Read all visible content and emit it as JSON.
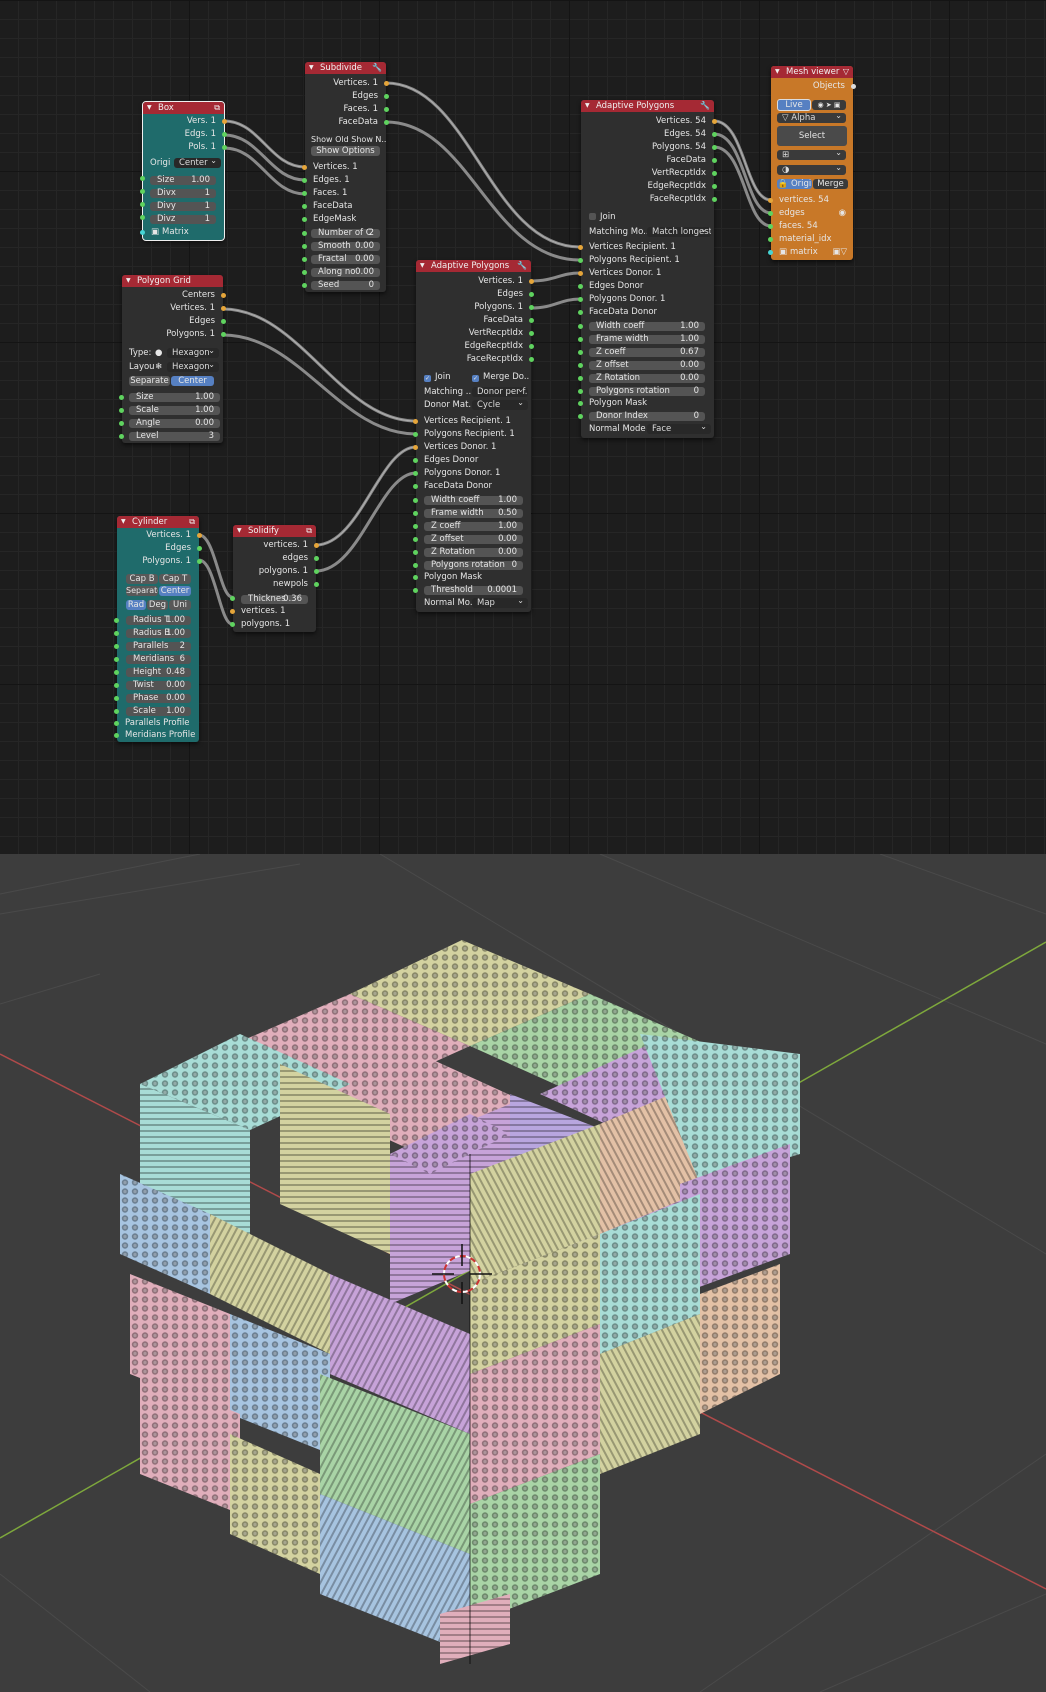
{
  "nodes": {
    "box": {
      "title": "Box",
      "outputs": [
        "Vers. 1",
        "Edgs. 1",
        "Pols. 1"
      ],
      "origin_label": "Origi",
      "origin_value": "Center",
      "fields": [
        {
          "label": "Size",
          "value": "1.00"
        },
        {
          "label": "Divx",
          "value": "1"
        },
        {
          "label": "Divy",
          "value": "1"
        },
        {
          "label": "Divz",
          "value": "1"
        }
      ],
      "matrix": "Matrix"
    },
    "subdivide": {
      "title": "Subdivide",
      "outputs": [
        "Vertices. 1",
        "Edges",
        "Faces. 1",
        "FaceData"
      ],
      "show_old": "Show Old Show N..",
      "show_options": "Show Options",
      "inputs": [
        "Vertices. 1",
        "Edges. 1",
        "Faces. 1",
        "FaceData",
        "EdgeMask"
      ],
      "fields": [
        {
          "label": "Number of C",
          "value": "2"
        },
        {
          "label": "Smooth",
          "value": "0.00"
        },
        {
          "label": "Fractal",
          "value": "0.00"
        },
        {
          "label": "Along no",
          "value": "0.00"
        },
        {
          "label": "Seed",
          "value": "0"
        }
      ]
    },
    "polygon_grid": {
      "title": "Polygon Grid",
      "outputs": [
        "Centers",
        "Vertices. 1",
        "Edges",
        "Polygons. 1"
      ],
      "type_label": "Type:",
      "type_value": "Hexagon",
      "layout_label": "Layou",
      "layout_value": "Hexagon",
      "separate": "Separate",
      "center": "Center",
      "fields": [
        {
          "label": "Size",
          "value": "1.00"
        },
        {
          "label": "Scale",
          "value": "1.00"
        },
        {
          "label": "Angle",
          "value": "0.00"
        },
        {
          "label": "Level",
          "value": "3"
        }
      ]
    },
    "cylinder": {
      "title": "Cylinder",
      "outputs": [
        "Vertices. 1",
        "Edges",
        "Polygons. 1"
      ],
      "cap_b": "Cap B",
      "cap_t": "Cap T",
      "separate": "Separate",
      "center": "Center",
      "rad": "Rad",
      "deg": "Deg",
      "uni": "Uni",
      "fields": [
        {
          "label": "Radius T",
          "value": "1.00"
        },
        {
          "label": "Radius B",
          "value": "1.00"
        },
        {
          "label": "Parallels",
          "value": "2"
        },
        {
          "label": "Meridians",
          "value": "6"
        },
        {
          "label": "Height",
          "value": "0.48"
        },
        {
          "label": "Twist",
          "value": "0.00"
        },
        {
          "label": "Phase",
          "value": "0.00"
        },
        {
          "label": "Scale",
          "value": "1.00"
        }
      ],
      "inputs": [
        "Parallels Profile",
        "Meridians Profile"
      ]
    },
    "solidify": {
      "title": "Solidify",
      "outputs": [
        "vertices. 1",
        "edges",
        "polygons. 1",
        "newpols"
      ],
      "fields": [
        {
          "label": "Thicknes",
          "value": "0.36"
        }
      ],
      "inputs": [
        "vertices. 1",
        "polygons. 1"
      ]
    },
    "adaptive1": {
      "title": "Adaptive Polygons",
      "outputs": [
        "Vertices. 1",
        "Edges",
        "Polygons. 1",
        "FaceData",
        "VertRecptIdx",
        "EdgeRecptIdx",
        "FaceRecptIdx"
      ],
      "join": "Join",
      "merge": "Merge Do..",
      "matching_label": "Matching ...",
      "matching_value": "Donor per f...",
      "donor_label": "Donor Mat...",
      "donor_value": "Cycle",
      "inputs": [
        "Vertices Recipient. 1",
        "Polygons Recipient. 1",
        "Vertices Donor. 1",
        "Edges Donor",
        "Polygons Donor. 1",
        "FaceData Donor"
      ],
      "fields": [
        {
          "label": "Width coeff",
          "value": "1.00"
        },
        {
          "label": "Frame width",
          "value": "0.50"
        },
        {
          "label": "Z coeff",
          "value": "1.00"
        },
        {
          "label": "Z offset",
          "value": "0.00"
        },
        {
          "label": "Z Rotation",
          "value": "0.00"
        },
        {
          "label": "Polygons rotation",
          "value": "0"
        }
      ],
      "mask": "Polygon Mask",
      "threshold_label": "Threshold",
      "threshold_value": "0.0001",
      "normal_label": "Normal Mo...",
      "normal_value": "Map"
    },
    "adaptive2": {
      "title": "Adaptive Polygons",
      "outputs": [
        "Vertices. 54",
        "Edges. 54",
        "Polygons. 54",
        "FaceData",
        "VertRecptIdx",
        "EdgeRecptIdx",
        "FaceRecptIdx"
      ],
      "join": "Join",
      "matching_label": "Matching Mo..",
      "matching_value": "Match longest",
      "inputs": [
        "Vertices Recipient. 1",
        "Polygons Recipient. 1",
        "Vertices Donor. 1",
        "Edges Donor",
        "Polygons Donor. 1",
        "FaceData Donor"
      ],
      "fields": [
        {
          "label": "Width coeff",
          "value": "1.00"
        },
        {
          "label": "Frame width",
          "value": "1.00"
        },
        {
          "label": "Z coeff",
          "value": "0.67"
        },
        {
          "label": "Z offset",
          "value": "0.00"
        },
        {
          "label": "Z Rotation",
          "value": "0.00"
        },
        {
          "label": "Polygons rotation",
          "value": "0"
        }
      ],
      "mask": "Polygon Mask",
      "donor_index_label": "Donor Index",
      "donor_index_value": "0",
      "normal_label": "Normal Mode",
      "normal_value": "Face"
    },
    "mesh_viewer": {
      "title": "Mesh viewer",
      "objects": "Objects",
      "live": "Live",
      "alpha": "Alpha",
      "select": "Select",
      "origin": "Origi",
      "merge": "Merge",
      "inputs": [
        "vertices. 54",
        "edges",
        "faces. 54",
        "material_idx",
        "matrix"
      ]
    }
  },
  "colors": {
    "header": "#a52934",
    "teal": "#1f6b6b",
    "orange": "#c87828",
    "x_axis": "#b04a4a",
    "y_axis": "#7ea83c",
    "blocks": [
      "#c7a3d9",
      "#e3c1a6",
      "#a9d4a6",
      "#a7c4e0",
      "#d3d2a0",
      "#b8a6df",
      "#a8dcd6",
      "#e0aebb"
    ]
  }
}
